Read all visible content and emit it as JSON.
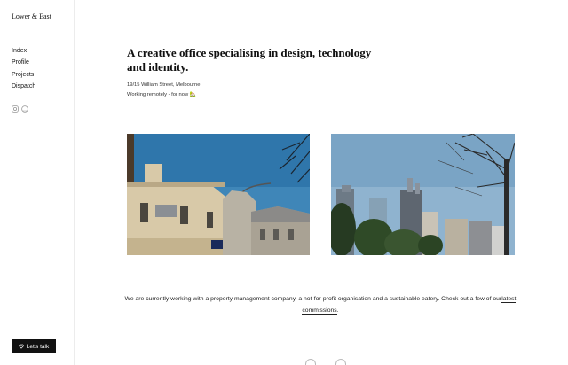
{
  "site": {
    "brand": "Lower & East"
  },
  "nav": {
    "items": [
      "Index",
      "Profile",
      "Projects",
      "Dispatch"
    ]
  },
  "social": {
    "icons": [
      "instagram-icon",
      "github-icon"
    ]
  },
  "cta": {
    "label": "Let's talk",
    "icon": "heart-icon"
  },
  "hero": {
    "headline": "A creative office specialising in design, technology and identity.",
    "address_line1": "19/15 William Street, Melbourne.",
    "address_line2": "Working remotely - for now 🏡"
  },
  "photos": [
    {
      "subject": "heritage-building-photo"
    },
    {
      "subject": "city-skyline-photo"
    }
  ],
  "blurb": {
    "text": "We are currently working with a property management company, a not-for-profit organisation and a sustainable eatery. Check out a few of our",
    "link_label": "latest commissions",
    "end": "."
  },
  "colors": {
    "sidebar_border": "#ececec",
    "cta_bg": "#111111",
    "sky": "#3f86b8"
  }
}
